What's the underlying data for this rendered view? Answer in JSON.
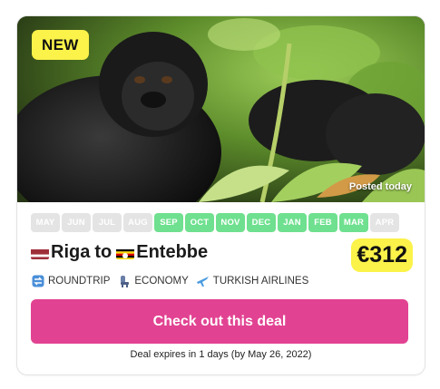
{
  "badge": "NEW",
  "posted": "Posted today",
  "months": [
    {
      "label": "MAY",
      "active": false
    },
    {
      "label": "JUN",
      "active": false
    },
    {
      "label": "JUL",
      "active": false
    },
    {
      "label": "AUG",
      "active": false
    },
    {
      "label": "SEP",
      "active": true
    },
    {
      "label": "OCT",
      "active": true
    },
    {
      "label": "NOV",
      "active": true
    },
    {
      "label": "DEC",
      "active": true
    },
    {
      "label": "JAN",
      "active": true
    },
    {
      "label": "FEB",
      "active": true
    },
    {
      "label": "MAR",
      "active": true
    },
    {
      "label": "APR",
      "active": false
    }
  ],
  "route": {
    "origin": "Riga",
    "connector": "to",
    "destination": "Entebbe",
    "origin_flag_icon": "latvia-flag-icon",
    "destination_flag_icon": "uganda-flag-icon"
  },
  "price": "€312",
  "tags": {
    "trip_type": "ROUNDTRIP",
    "cabin": "ECONOMY",
    "airline": "TURKISH AIRLINES"
  },
  "cta_label": "Check out this deal",
  "expires": "Deal expires in 1 days (by May 26, 2022)",
  "colors": {
    "accent": "#e24292",
    "highlight": "#fbf24a",
    "month_active": "#6fe08f",
    "month_inactive": "#e4e4e4"
  }
}
